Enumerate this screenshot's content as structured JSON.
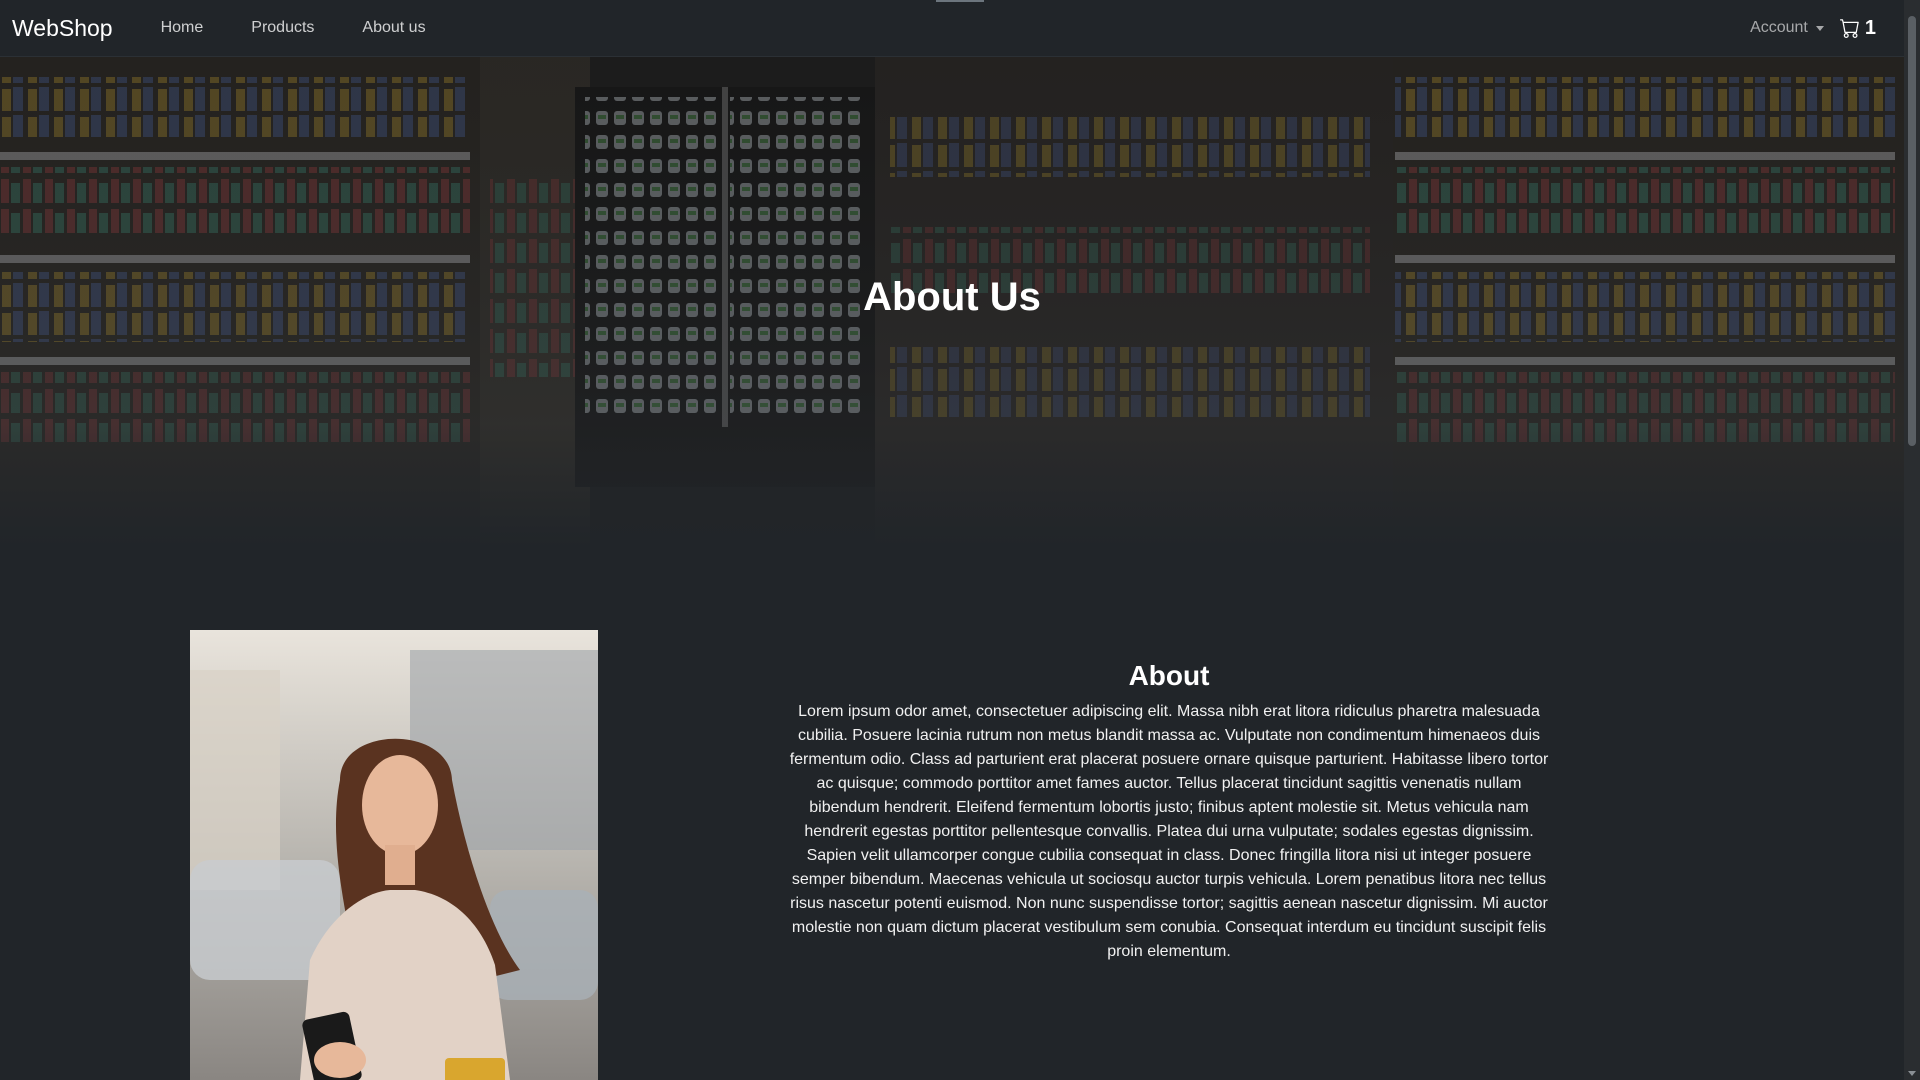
{
  "navbar": {
    "brand": "WebShop",
    "links": [
      "Home",
      "Products",
      "About us"
    ],
    "account_label": "Account",
    "cart_count": "1",
    "cart_icon": "cart-icon"
  },
  "hero": {
    "title": "About Us",
    "background": "store-shelves-image"
  },
  "about": {
    "heading": "About",
    "body": "Lorem ipsum odor amet, consectetuer adipiscing elit. Massa nibh erat litora ridiculus pharetra malesuada cubilia. Posuere lacinia rutrum non metus blandit massa ac. Vulputate non condimentum himenaeos duis fermentum odio. Class ad parturient erat placerat posuere ornare quisque parturient. Habitasse libero tortor ac quisque; commodo porttitor amet fames auctor. Tellus placerat tincidunt sagittis venenatis nullam bibendum hendrerit. Eleifend fermentum lobortis justo; finibus aptent molestie sit. Metus vehicula nam hendrerit egestas porttitor pellentesque convallis. Platea dui urna vulputate; sodales egestas dignissim. Sapien velit ullamcorper congue cubilia consequat in class. Donec fringilla litora nisi ut integer posuere semper bibendum. Maecenas vehicula ut sociosqu auctor turpis vehicula. Lorem penatibus litora nec tellus risus nascetur potenti euismod. Non nunc suspendisse tortor; sagittis aenean nascetur dignissim. Mi auctor molestie non quam dictum placerat vestibulum sem conubia. Consequat interdum eu tincidunt suscipit felis proin elementum.",
    "photo": "woman-with-phone-and-card-photo"
  },
  "colors": {
    "page_bg": "#212529",
    "navbar_bg": "#212529",
    "text": "#ffffff"
  }
}
